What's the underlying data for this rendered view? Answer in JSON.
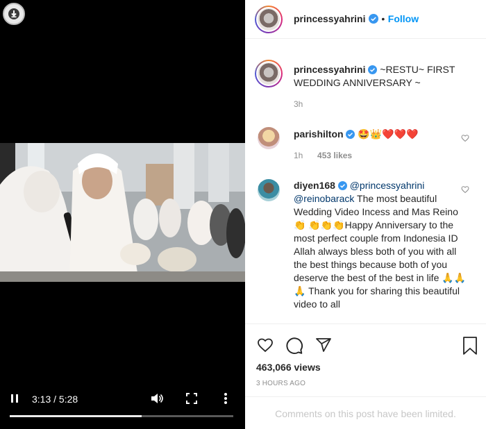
{
  "video": {
    "time_current": "3:13",
    "time_total": "5:28",
    "time_sep": " / ",
    "progress_fraction": 0.59
  },
  "header": {
    "username": "princessyahrini",
    "separator": "•",
    "follow_label": "Follow"
  },
  "caption": {
    "username": "princessyahrini",
    "text": "~RESTU~ FIRST WEDDING ANNIVERSARY ~",
    "time": "3h"
  },
  "comments": [
    {
      "username": "parishilton",
      "text": "🤩👑❤️❤️❤️",
      "time": "1h",
      "likes": "453 likes"
    },
    {
      "username": "diyen168",
      "mention1": "@princessyahrini",
      "mention2": "@reinobarack",
      "text": " The most beautiful Wedding Video Incess and Mas Reino👏 👏👏👏Happy Anniversary to the most perfect couple from Indonesia ID Allah always bless both of you with all the best things because both of you deserve the best of the best in life 🙏🙏🙏 Thank you for sharing this beautiful video to all"
    }
  ],
  "stats": {
    "views": "463,066 views",
    "posted": "3 HOURS AGO"
  },
  "footer": {
    "limited_text": "Comments on this post have been limited."
  },
  "colors": {
    "follow": "#0095f6",
    "verified": "#3897f0",
    "muted": "#8e8e8e"
  }
}
